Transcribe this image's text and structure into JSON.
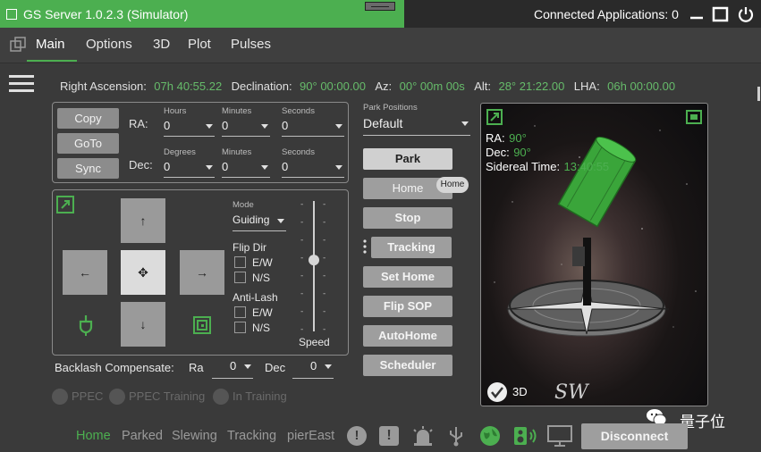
{
  "window": {
    "title": "GS Server  1.0.2.3 (Simulator)",
    "connected_label": "Connected Applications: 0"
  },
  "menu": {
    "items": [
      "Main",
      "Options",
      "3D",
      "Plot",
      "Pulses"
    ]
  },
  "coords": {
    "ra_label": "Right Ascension:",
    "ra_value": "07h 40:55.22",
    "dec_label": "Declination:",
    "dec_value": "90° 00:00.00",
    "az_label": "Az:",
    "az_value": "00° 00m 00s",
    "alt_label": "Alt:",
    "alt_value": "28° 21:22.00",
    "lha_label": "LHA:",
    "lha_value": "06h 00:00.00"
  },
  "goto_panel": {
    "copy": "Copy",
    "goto": "GoTo",
    "sync": "Sync",
    "ra_label": "RA:",
    "dec_label": "Dec:",
    "ra_fields": [
      {
        "label": "Hours",
        "value": "0"
      },
      {
        "label": "Minutes",
        "value": "0"
      },
      {
        "label": "Seconds",
        "value": "0"
      }
    ],
    "dec_fields": [
      {
        "label": "Degrees",
        "value": "0"
      },
      {
        "label": "Minutes",
        "value": "0"
      },
      {
        "label": "Seconds",
        "value": "0"
      }
    ]
  },
  "slew_panel": {
    "up": "↑",
    "down": "↓",
    "left": "←",
    "right": "→",
    "center": "✥",
    "mode_label": "Mode",
    "mode_value": "Guiding",
    "flipdir_label": "Flip Dir",
    "ew": "E/W",
    "ns": "N/S",
    "antilash_label": "Anti-Lash",
    "ew2": "E/W",
    "ns2": "N/S",
    "speed_label": "Speed",
    "speed_level": 0.55
  },
  "backlash": {
    "label": "Backlash Compensate:",
    "ra_label": "Ra",
    "ra_value": "0",
    "dec_label": "Dec",
    "dec_value": "0"
  },
  "ppec": {
    "ppec": "PPEC",
    "training": "PPEC Training",
    "in_training": "In Training"
  },
  "park": {
    "label": "Park Positions",
    "value": "Default",
    "buttons": [
      "Park",
      "Home",
      "Stop",
      "Tracking",
      "Set Home",
      "Flip SOP",
      "AutoHome",
      "Scheduler"
    ],
    "home_badge": "Home"
  },
  "sky": {
    "ra_label": "RA:",
    "ra_value": "90°",
    "dec_label": "Dec:",
    "dec_value": "90°",
    "sidereal_label": "Sidereal Time:",
    "sidereal_value": "13:40:55",
    "toggle_3d": "3D",
    "logo": "SW"
  },
  "status": {
    "home": "Home",
    "parked": "Parked",
    "slewing": "Slewing",
    "tracking": "Tracking",
    "pier": "pierEast",
    "disconnect": "Disconnect"
  },
  "watermark": "量子位",
  "colors": {
    "accent": "#4caf50",
    "value_green": "#66bb6a"
  }
}
